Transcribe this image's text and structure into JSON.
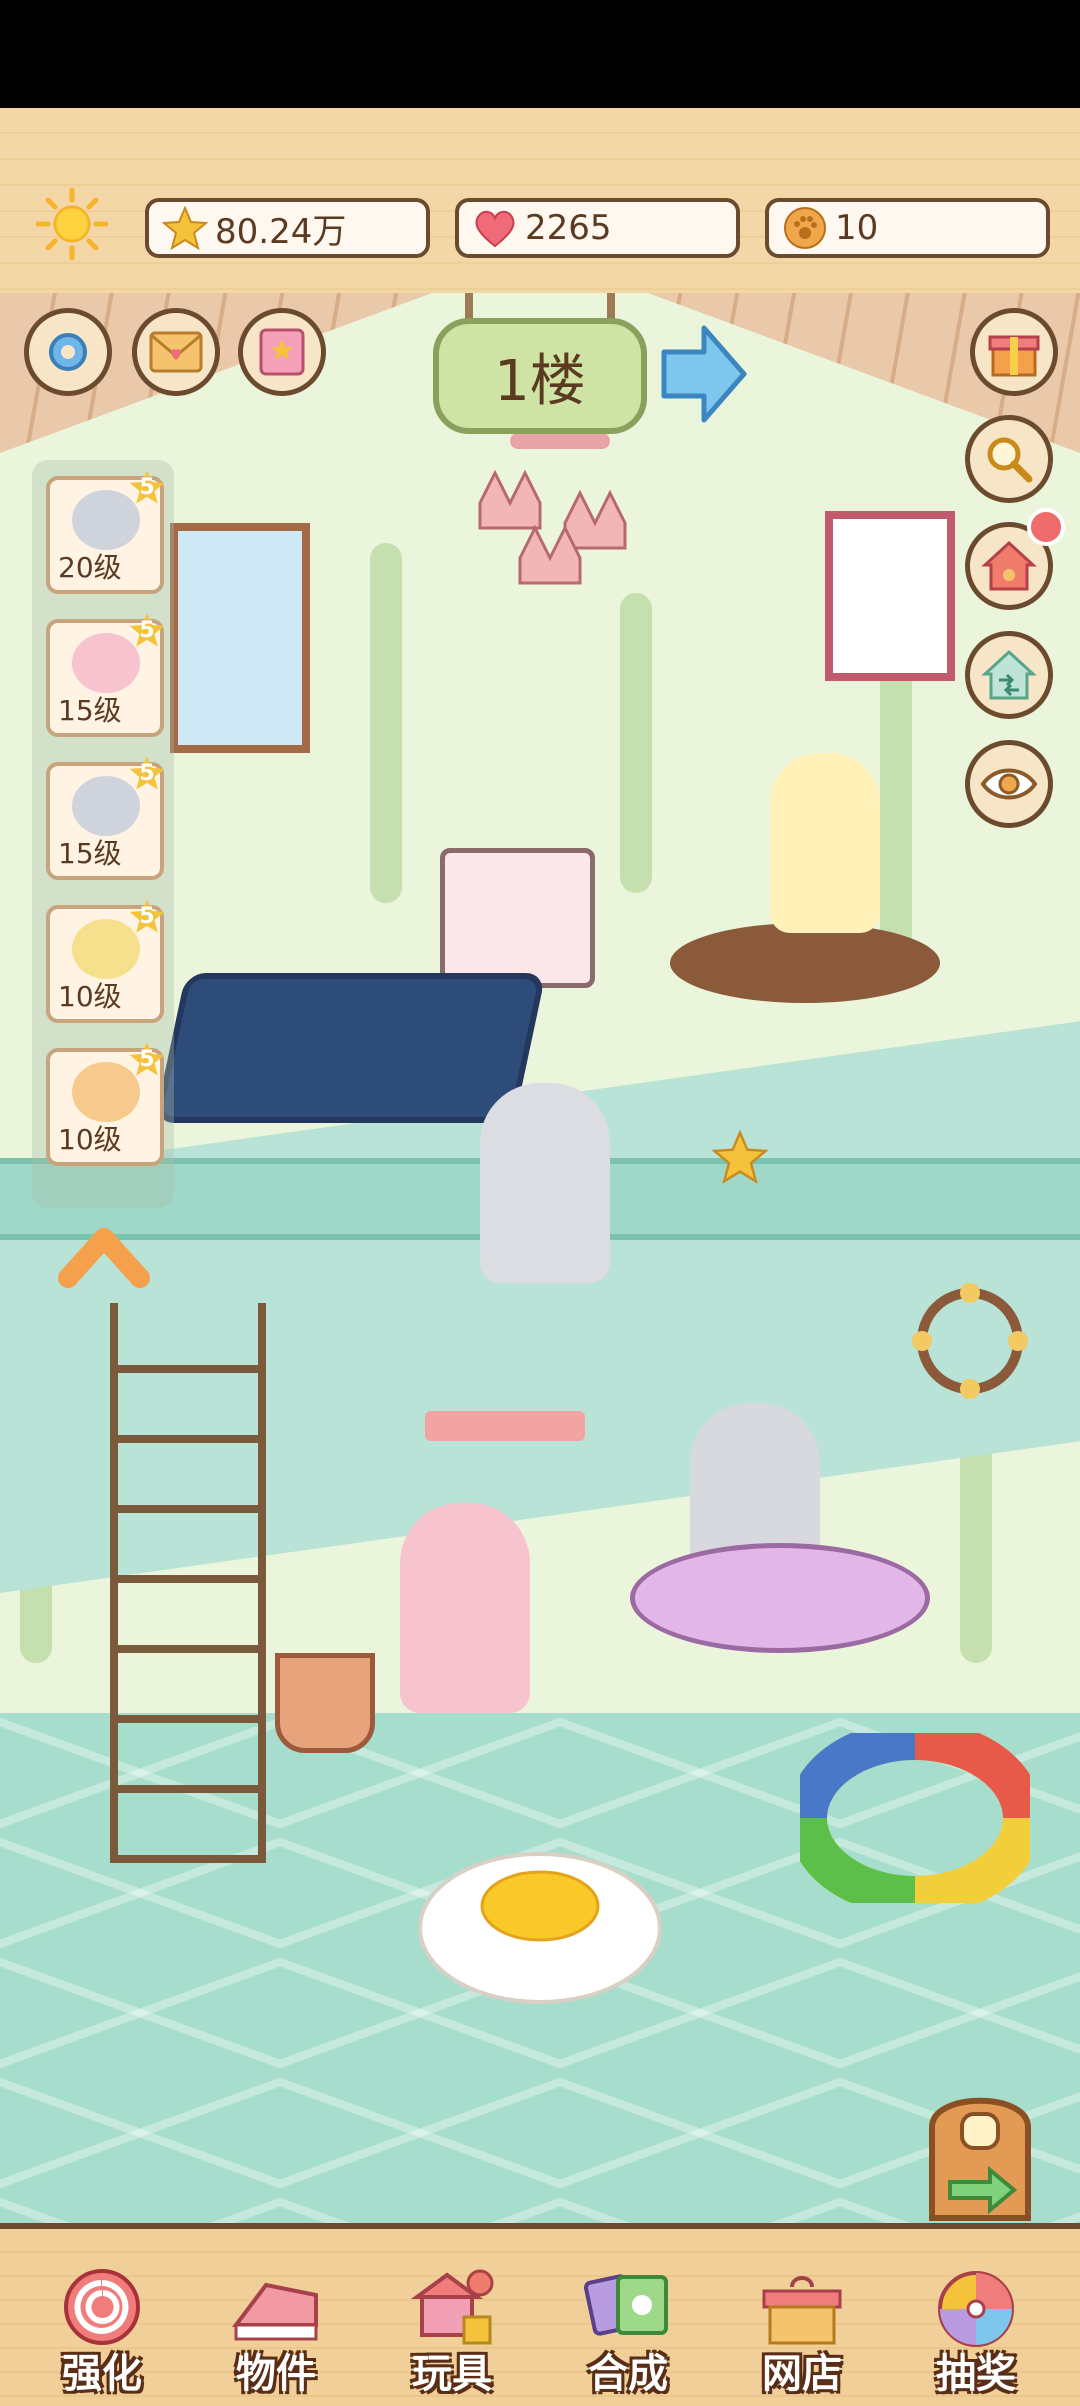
{
  "resources": {
    "stars": "80.24万",
    "hearts": "2265",
    "coins": "10"
  },
  "floor": {
    "label": "1楼"
  },
  "characters": [
    {
      "level": "20级",
      "badge": "5",
      "color": "#cfd3dc"
    },
    {
      "level": "15级",
      "badge": "5",
      "color": "#f6c3cf"
    },
    {
      "level": "15级",
      "badge": "5",
      "color": "#cfd3dc"
    },
    {
      "level": "10级",
      "badge": "5",
      "color": "#f7e08d"
    },
    {
      "level": "10级",
      "badge": "5",
      "color": "#f7c98d"
    }
  ],
  "nav": {
    "strengthen": "强化",
    "items": "物件",
    "toys": "玩具",
    "merge": "合成",
    "shop": "网店",
    "lottery": "抽奖"
  },
  "colors": {
    "wood_border": "#6b4a2d",
    "star": "#f5c33b",
    "heart": "#ef6b7a",
    "coin": "#f0a64a",
    "nav_label_outline": "#5a2e16"
  }
}
